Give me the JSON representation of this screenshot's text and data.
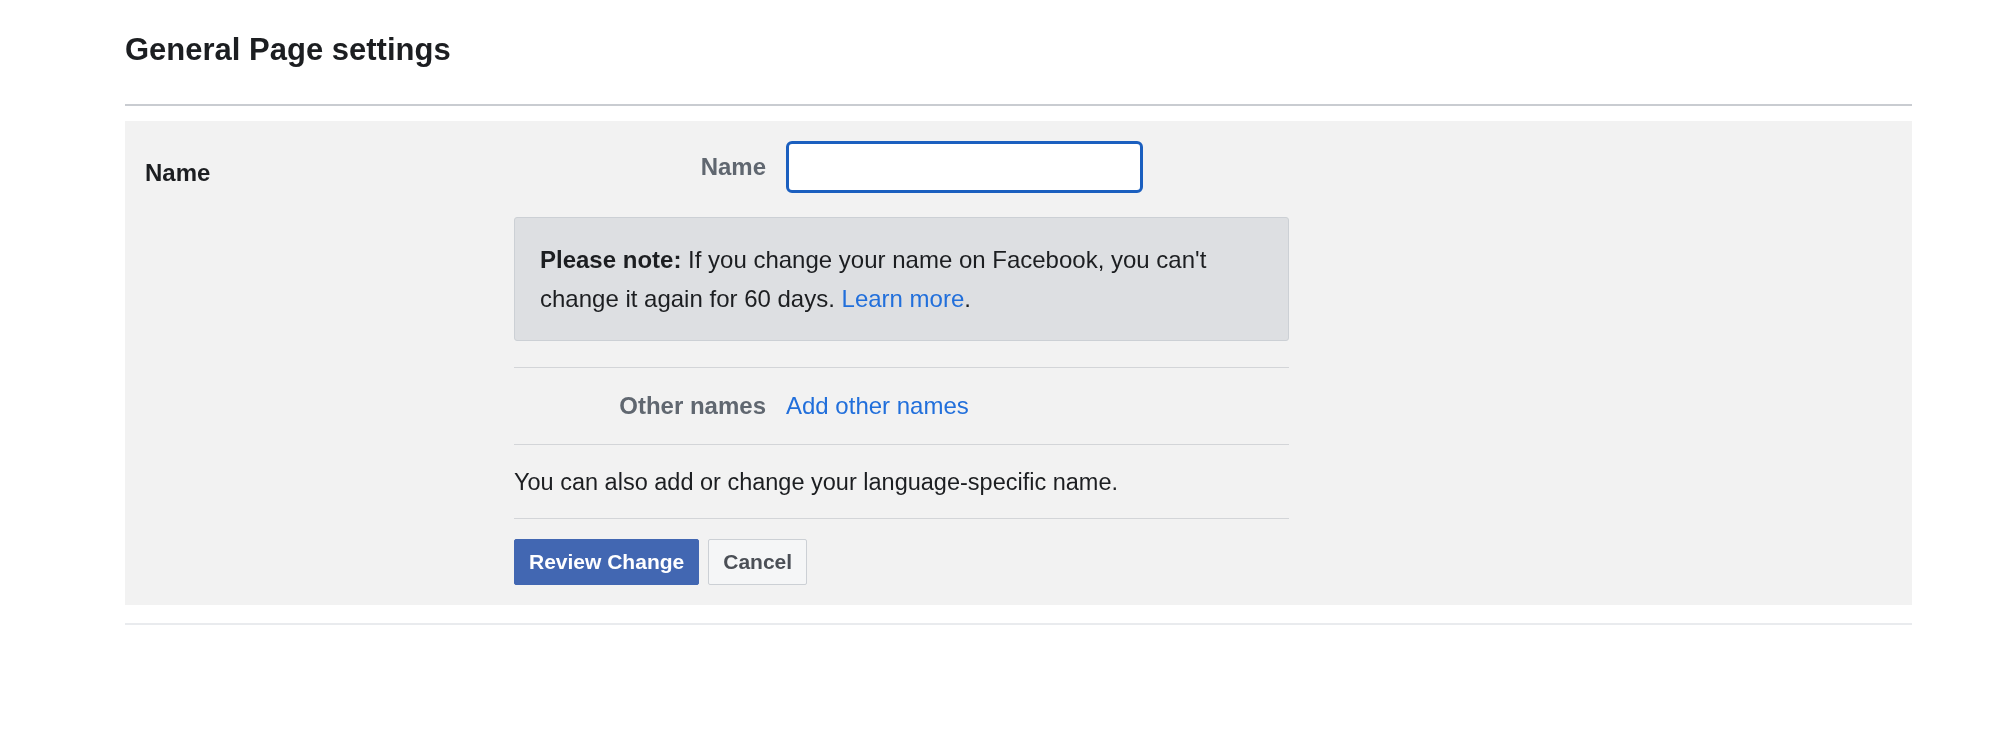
{
  "heading": "General Page settings",
  "section": {
    "label": "Name",
    "name_field": {
      "label": "Name",
      "focused": true
    },
    "note": {
      "text": "**Please note:** If you change your name on Facebook, you can't change it again for 60 days. ",
      "link": "Learn more",
      "after": "."
    },
    "other_names": {
      "label": "Other names",
      "link": "Add other names"
    },
    "language_note": "You can also add or change your language-specific name.",
    "buttons": [
      {
        "label": "Review Change",
        "kind": "primary"
      },
      {
        "label": "Cancel",
        "kind": "secondary"
      }
    ]
  }
}
